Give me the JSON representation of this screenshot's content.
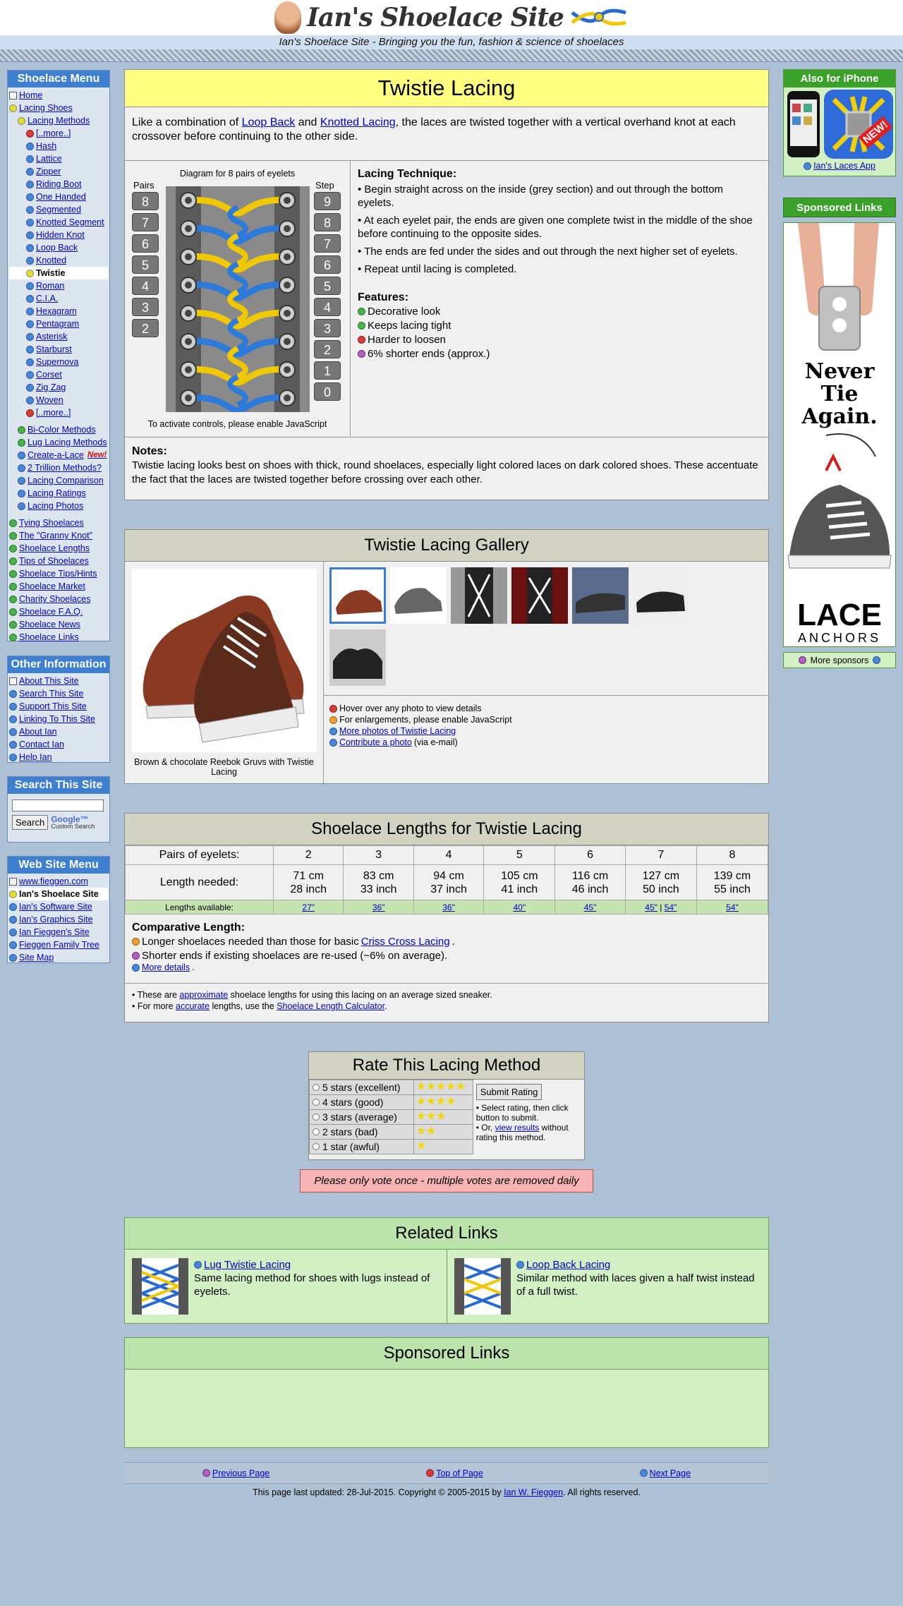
{
  "site": {
    "logo_text": "Ian's Shoelace Site",
    "tagline": "Ian's Shoelace Site - Bringing you the fun, fashion & science of shoelaces"
  },
  "menu": {
    "title": "Shoelace Menu",
    "items": [
      {
        "label": "Home",
        "b": "hm",
        "i": 0
      },
      {
        "label": "Lacing Shoes",
        "b": "sel",
        "i": 0
      },
      {
        "label": "Lacing Methods",
        "b": "sel",
        "i": 1
      },
      {
        "label": "[..more..]",
        "b": "red",
        "i": 2
      },
      {
        "label": "Hash",
        "b": "blu",
        "i": 2
      },
      {
        "label": "Lattice",
        "b": "blu",
        "i": 2
      },
      {
        "label": "Zipper",
        "b": "blu",
        "i": 2
      },
      {
        "label": "Riding Boot",
        "b": "blu",
        "i": 2
      },
      {
        "label": "One Handed",
        "b": "blu",
        "i": 2
      },
      {
        "label": "Segmented",
        "b": "blu",
        "i": 2
      },
      {
        "label": "Knotted Segment",
        "b": "blu",
        "i": 2
      },
      {
        "label": "Hidden Knot",
        "b": "blu",
        "i": 2
      },
      {
        "label": "Loop Back",
        "b": "blu",
        "i": 2
      },
      {
        "label": "Knotted",
        "b": "blu",
        "i": 2
      },
      {
        "label": "Twistie",
        "b": "sel",
        "i": 2,
        "cur": true
      },
      {
        "label": "Roman",
        "b": "blu",
        "i": 2
      },
      {
        "label": "C.I.A.",
        "b": "blu",
        "i": 2
      },
      {
        "label": "Hexagram",
        "b": "blu",
        "i": 2
      },
      {
        "label": "Pentagram",
        "b": "blu",
        "i": 2
      },
      {
        "label": "Asterisk",
        "b": "blu",
        "i": 2
      },
      {
        "label": "Starburst",
        "b": "blu",
        "i": 2
      },
      {
        "label": "Supernova",
        "b": "blu",
        "i": 2
      },
      {
        "label": "Corset",
        "b": "blu",
        "i": 2
      },
      {
        "label": "Zig Zag",
        "b": "blu",
        "i": 2
      },
      {
        "label": "Woven",
        "b": "blu",
        "i": 2
      },
      {
        "label": "[..more..]",
        "b": "red",
        "i": 2
      },
      {
        "label": "Bi-Color Methods",
        "b": "grn",
        "i": 1,
        "gap": true
      },
      {
        "label": "Lug Lacing Methods",
        "b": "grn",
        "i": 1
      },
      {
        "label": "Create-a-Lace",
        "b": "blu",
        "i": 1,
        "new": "New!"
      },
      {
        "label": "2 Trillion Methods?",
        "b": "blu",
        "i": 1
      },
      {
        "label": "Lacing Comparison",
        "b": "blu",
        "i": 1
      },
      {
        "label": "Lacing Ratings",
        "b": "blu",
        "i": 1
      },
      {
        "label": "Lacing Photos",
        "b": "blu",
        "i": 1
      },
      {
        "label": "Tying Shoelaces",
        "b": "grn",
        "i": 0,
        "gap": true
      },
      {
        "label": "The \"Granny Knot\"",
        "b": "grn",
        "i": 0
      },
      {
        "label": "Shoelace Lengths",
        "b": "grn",
        "i": 0
      },
      {
        "label": "Tips of Shoelaces",
        "b": "grn",
        "i": 0
      },
      {
        "label": "Shoelace Tips/Hints",
        "b": "grn",
        "i": 0
      },
      {
        "label": "Shoelace Market",
        "b": "grn",
        "i": 0
      },
      {
        "label": "Charity Shoelaces",
        "b": "grn",
        "i": 0
      },
      {
        "label": "Shoelace F.A.Q.",
        "b": "grn",
        "i": 0
      },
      {
        "label": "Shoelace News",
        "b": "grn",
        "i": 0
      },
      {
        "label": "Shoelace Links",
        "b": "grn",
        "i": 0
      }
    ]
  },
  "other": {
    "title": "Other Information",
    "items": [
      "About This Site",
      "Search This Site",
      "Support This Site",
      "Linking To This Site",
      "About Ian",
      "Contact Ian",
      "Help Ian"
    ]
  },
  "search": {
    "title": "Search This Site",
    "button": "Search",
    "google": "Google™",
    "custom": "Custom Search"
  },
  "webmenu": {
    "title": "Web Site Menu",
    "items": [
      "www.fieggen.com",
      "Ian's Shoelace Site",
      "Ian's Software Site",
      "Ian's Graphics Site",
      "Ian Fieggen's Site",
      "Fieggen Family Tree",
      "Site Map"
    ]
  },
  "main": {
    "title": "Twistie Lacing",
    "intro_a": "Like a combination of ",
    "intro_link1": "Loop Back",
    "intro_b": " and ",
    "intro_link2": "Knotted Lacing",
    "intro_c": ", the laces are twisted together with a vertical overhand knot at each crossover before continuing to the other side.",
    "diagram_caption": "Diagram for 8 pairs of eyelets",
    "pairs_label": "Pairs",
    "step_label": "Step",
    "pairs": [
      "8",
      "7",
      "6",
      "5",
      "4",
      "3",
      "2"
    ],
    "steps": [
      "9",
      "8",
      "7",
      "6",
      "5",
      "4",
      "3",
      "2",
      "1",
      "0"
    ],
    "js_note": "To activate controls, please enable JavaScript",
    "technique_title": "Lacing Technique:",
    "technique": [
      "• Begin straight across on the inside (grey section) and out through the bottom eyelets.",
      "• At each eyelet pair, the ends are given one complete twist in the middle of the shoe before continuing to the opposite sides.",
      "• The ends are fed under the sides and out through the next higher set of eyelets.",
      "• Repeat until lacing is completed."
    ],
    "features_title": "Features:",
    "features": [
      {
        "t": "Decorative look",
        "b": "grn"
      },
      {
        "t": "Keeps lacing tight",
        "b": "grn"
      },
      {
        "t": "Harder to loosen",
        "b": "red"
      },
      {
        "t": "6% shorter ends (approx.)",
        "b": "pur"
      }
    ],
    "notes_title": "Notes:",
    "notes": "Twistie lacing looks best on shoes with thick, round shoelaces, especially light colored laces on dark colored shoes. These accentuate the fact that the laces are twisted together before crossing over each other."
  },
  "gallery": {
    "title": "Twistie Lacing Gallery",
    "caption": "Brown & chocolate Reebok Gruvs with Twistie Lacing",
    "hover": "Hover over any photo to view details",
    "enlarge": "For enlargements, please enable JavaScript",
    "more": "More photos of Twistie Lacing",
    "contribute": "Contribute a photo",
    "via": " (via e-mail)"
  },
  "lengths": {
    "title": "Shoelace Lengths for Twistie Lacing",
    "pairs_label": "Pairs of eyelets:",
    "needed_label": "Length needed:",
    "available_label": "Lengths available:",
    "cols": [
      {
        "p": "2",
        "cm": "71 cm",
        "in": "28 inch",
        "a": "27\""
      },
      {
        "p": "3",
        "cm": "83 cm",
        "in": "33 inch",
        "a": "36\""
      },
      {
        "p": "4",
        "cm": "94 cm",
        "in": "37 inch",
        "a": "36\""
      },
      {
        "p": "5",
        "cm": "105 cm",
        "in": "41 inch",
        "a": "40\""
      },
      {
        "p": "6",
        "cm": "116 cm",
        "in": "46 inch",
        "a": "45\""
      },
      {
        "p": "7",
        "cm": "127 cm",
        "in": "50 inch",
        "a": "45\"",
        "a2": "54\""
      },
      {
        "p": "8",
        "cm": "139 cm",
        "in": "55 inch",
        "a": "54\""
      }
    ],
    "comp_title": "Comparative Length:",
    "comp1a": "Longer shoelaces needed than those for basic ",
    "comp1link": "Criss Cross Lacing",
    "comp1b": ".",
    "comp2": "Shorter ends if existing shoelaces are re-used (~6% on average).",
    "more": "More details",
    "note1a": "• These are ",
    "note1link": "approximate",
    "note1b": " shoelace lengths for using this lacing on an average sized sneaker.",
    "note2a": "• For more ",
    "note2link": "accurate",
    "note2b": " lengths, use the ",
    "note2link2": "Shoelace Length Calculator",
    "note2c": "."
  },
  "rate": {
    "title": "Rate This Lacing Method",
    "options": [
      {
        "l": "5 stars (excellent)",
        "n": 5
      },
      {
        "l": "4 stars (good)",
        "n": 4
      },
      {
        "l": "3 stars (average)",
        "n": 3
      },
      {
        "l": "2 stars (bad)",
        "n": 2
      },
      {
        "l": "1 star (awful)",
        "n": 1
      }
    ],
    "button": "Submit Rating",
    "hint1": "• Select rating, then click button to submit.",
    "hint2a": "• Or, ",
    "hint2link": "view results",
    "hint2b": " without rating this method.",
    "warning": "Please only vote once - multiple votes are removed daily"
  },
  "related": {
    "title": "Related Links",
    "items": [
      {
        "title": "Lug Twistie Lacing",
        "desc": "Same lacing method for shoes with lugs instead of eyelets."
      },
      {
        "title": "Loop Back Lacing",
        "desc": "Similar method with laces given a half twist instead of a full twist."
      }
    ]
  },
  "sponsored_main": {
    "title": "Sponsored Links"
  },
  "right": {
    "iphone_title": "Also for iPhone",
    "new_badge": "NEW!",
    "app_link": "Ian's Laces App",
    "sponsored_title": "Sponsored Links",
    "ad_text": "Never Tie Again.",
    "ad_brand": "LACE",
    "ad_brand2": "ANCHORS",
    "more_sponsors": "More sponsors"
  },
  "footer": {
    "prev": "Previous Page",
    "top": "Top of Page",
    "next": "Next Page",
    "updated": "This page last updated: 28-Jul-2015. Copyright © 2005-2015 by ",
    "author": "Ian W. Fieggen",
    "rights": ". All rights reserved."
  }
}
